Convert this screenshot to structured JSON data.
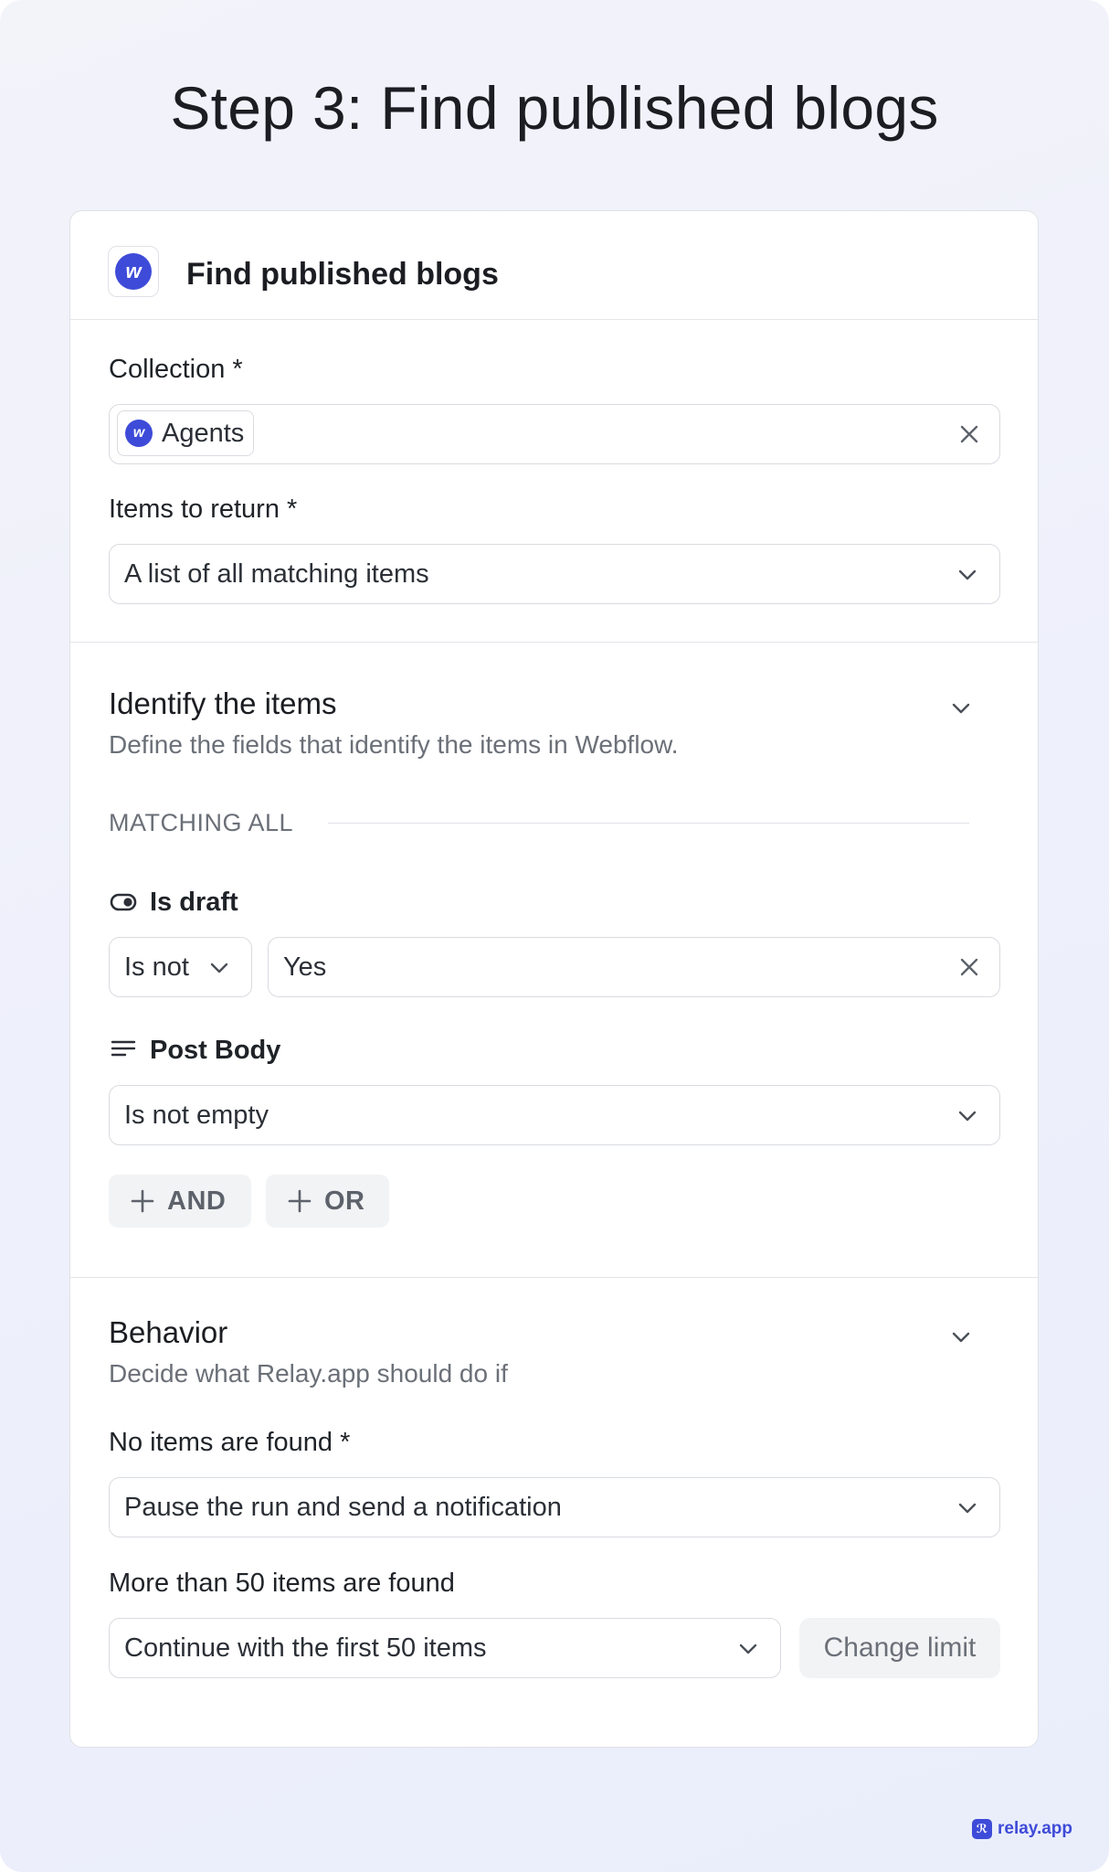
{
  "page_title": "Step 3: Find published blogs",
  "card": {
    "title": "Find published blogs",
    "icon": "webflow-logo",
    "logo_letter": "w"
  },
  "collection": {
    "label": "Collection *",
    "value": "Agents"
  },
  "items_to_return": {
    "label": "Items to return *",
    "value": "A list of all matching items"
  },
  "identify": {
    "title": "Identify the items",
    "subtitle": "Define the fields that identify the items in Webflow.",
    "matching_label": "MATCHING ALL",
    "conditions": [
      {
        "icon": "toggle-icon",
        "field": "Is draft",
        "operator": "Is not",
        "value": "Yes"
      },
      {
        "icon": "text-lines-icon",
        "field": "Post Body",
        "operator": "Is not empty"
      }
    ],
    "and_label": "AND",
    "or_label": "OR"
  },
  "behavior": {
    "title": "Behavior",
    "subtitle": "Decide what Relay.app should do if",
    "no_items": {
      "label": "No items are found *",
      "value": "Pause the run and send a notification"
    },
    "more_than": {
      "label": "More than 50 items are found",
      "value": "Continue with the first 50 items",
      "change_limit_label": "Change limit"
    }
  },
  "brand": {
    "name": "relay.app",
    "accent": "#3e4bd8"
  }
}
